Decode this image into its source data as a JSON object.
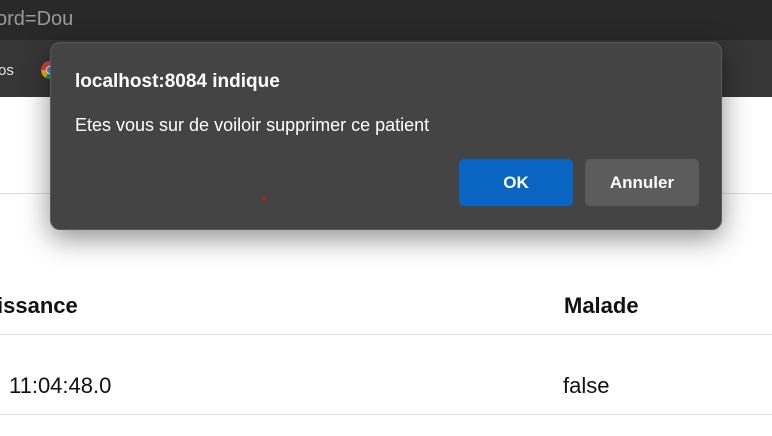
{
  "browser": {
    "url_fragment": "ord=Dou",
    "bookmark_fragment": "os"
  },
  "table": {
    "headers": {
      "date": "issance",
      "malade": "Malade"
    },
    "rows": [
      {
        "date": "11:04:48.0",
        "malade": "false"
      }
    ]
  },
  "dialog": {
    "title": "localhost:8084 indique",
    "message": "Etes vous sur de voiloir supprimer ce patient",
    "ok_label": "OK",
    "cancel_label": "Annuler"
  },
  "colors": {
    "dialog_bg": "#444444",
    "ok_button": "#0a64c1",
    "cancel_button": "#5c5c5c",
    "chrome_bg": "#292929"
  }
}
